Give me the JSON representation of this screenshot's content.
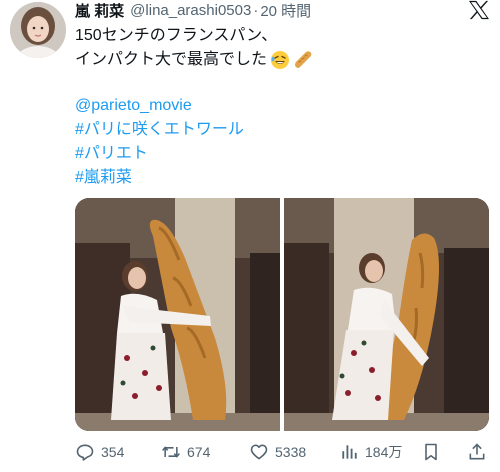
{
  "author": {
    "name": "嵐 莉菜",
    "handle": "@lina_arashi0503",
    "separator": "·",
    "time": "20 時間"
  },
  "tweet": {
    "line1": "150センチのフランスパン、",
    "line2": "インパクト大で最高でした",
    "line2_emojis": [
      "rolling-laughing-emoji",
      "baguette-emoji"
    ],
    "mention": "@parieto_movie",
    "hashtags": [
      "#パリに咲くエトワール",
      "#パリエト",
      "#嵐莉菜"
    ]
  },
  "media": {
    "photos": [
      "photo-left",
      "photo-right"
    ]
  },
  "actions": {
    "replies": "354",
    "reposts": "674",
    "likes": "5338",
    "views": "184万"
  },
  "colors": {
    "link": "#1d9bf0",
    "muted": "#536471",
    "text": "#0f1419"
  },
  "icons": [
    "x-logo-icon",
    "reply-icon",
    "repost-icon",
    "like-icon",
    "views-icon",
    "bookmark-icon",
    "share-icon"
  ]
}
